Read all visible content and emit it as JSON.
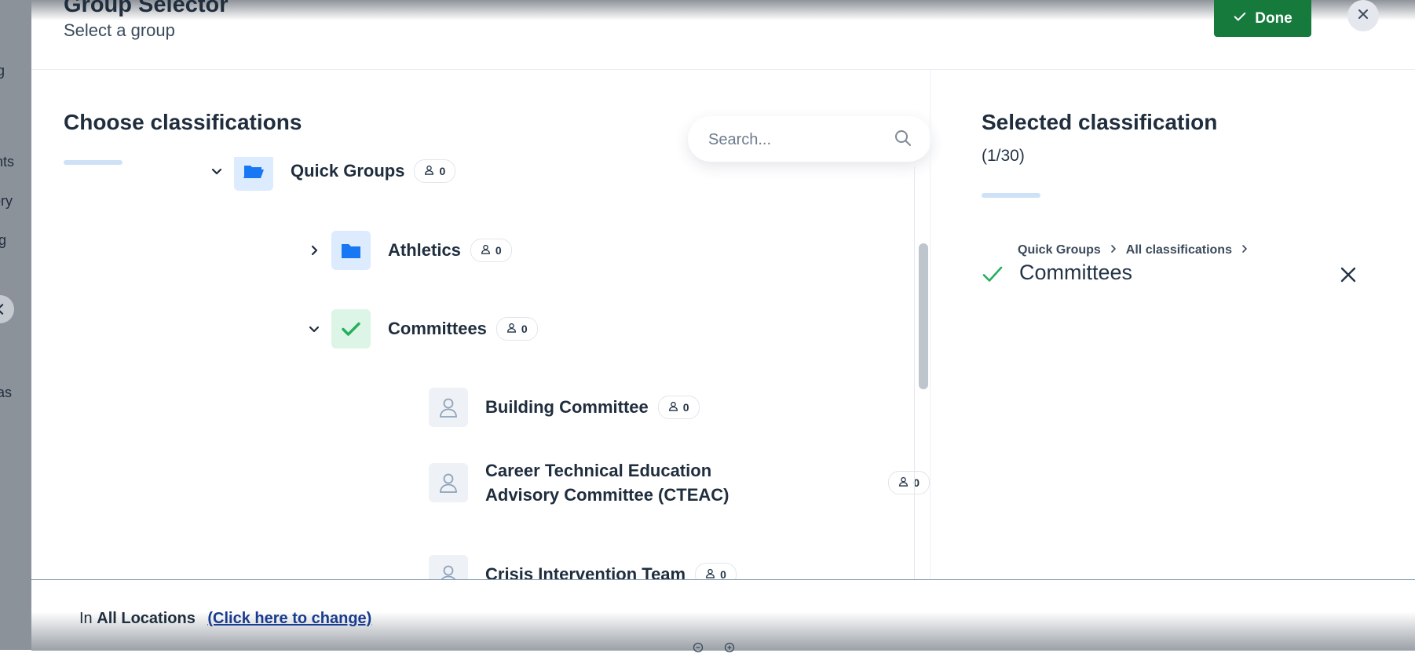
{
  "background_nav": {
    "items": [
      "ig",
      "ents",
      "tory",
      "ig",
      "as"
    ]
  },
  "modal": {
    "title": "Group Selector",
    "subtitle": "Select a group",
    "done_label": "Done"
  },
  "left_panel": {
    "title": "Choose classifications",
    "search": {
      "placeholder": "Search...",
      "value": ""
    },
    "tree": [
      {
        "label": "Quick Groups",
        "count": "0",
        "icon": "folder-open-icon",
        "expanded": true
      },
      {
        "label": "Athletics",
        "count": "0",
        "icon": "folder-icon",
        "expanded": false
      },
      {
        "label": "Committees",
        "count": "0",
        "icon": "check-icon",
        "expanded": true
      },
      {
        "label": "Building Committee",
        "count": "0",
        "icon": "person-icon"
      },
      {
        "label": "Career Technical Education Advisory Committee (CTEAC)",
        "count": "0",
        "icon": "person-icon"
      },
      {
        "label": "Crisis Intervention Team",
        "count": "0",
        "icon": "person-icon"
      }
    ]
  },
  "right_panel": {
    "title": "Selected classification",
    "count": "(1/30)",
    "selected": {
      "breadcrumb": [
        "Quick Groups",
        "All classifications"
      ],
      "name": "Committees"
    }
  },
  "footer": {
    "prefix": "In",
    "location": "All Locations",
    "link": "(Click here to change)"
  },
  "colors": {
    "done_button": "#157a3c",
    "accent_blue": "#1877f2",
    "check_green": "#22b05c",
    "text_dark": "#1f2d3d"
  }
}
